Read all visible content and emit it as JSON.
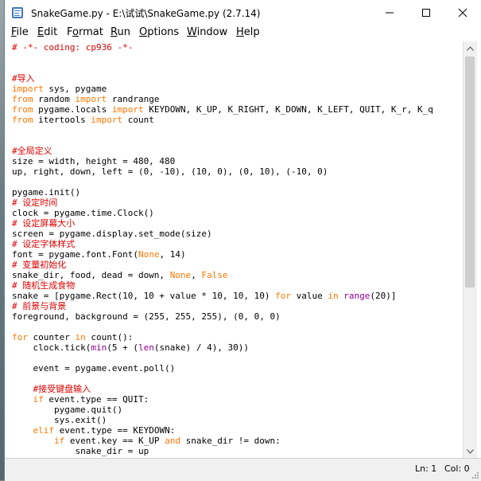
{
  "window": {
    "title": "SnakeGame.py - E:\\试试\\SnakeGame.py (2.7.14)",
    "minimize_glyph": "—",
    "maximize_glyph": "☐",
    "close_glyph": "✕"
  },
  "menu": [
    "File",
    "Edit",
    "Format",
    "Run",
    "Options",
    "Window",
    "Help"
  ],
  "menu_underline": [
    "F",
    "E",
    "o",
    "R",
    "O",
    "W",
    "H"
  ],
  "code_lines": [
    [
      [
        "# -*- coding: cp936 -*-",
        "c"
      ]
    ],
    [],
    [],
    [
      [
        "#导入",
        "c"
      ]
    ],
    [
      [
        "import",
        "k"
      ],
      [
        " sys, pygame",
        "t"
      ]
    ],
    [
      [
        "from",
        "k"
      ],
      [
        " random ",
        "t"
      ],
      [
        "import",
        "k"
      ],
      [
        " randrange",
        "t"
      ]
    ],
    [
      [
        "from",
        "k"
      ],
      [
        " pygame.locals ",
        "t"
      ],
      [
        "import",
        "k"
      ],
      [
        " KEYDOWN, K_UP, K_RIGHT, K_DOWN, K_LEFT, QUIT, K_r, K_q",
        "t"
      ]
    ],
    [
      [
        "from",
        "k"
      ],
      [
        " itertools ",
        "t"
      ],
      [
        "import",
        "k"
      ],
      [
        " count",
        "t"
      ]
    ],
    [],
    [],
    [
      [
        "#全局定义",
        "c"
      ]
    ],
    [
      [
        "size = width, height = 480, 480",
        "t"
      ]
    ],
    [
      [
        "up, right, down, left = (0, -10), (10, 0), (0, 10), (-10, 0)",
        "t"
      ]
    ],
    [],
    [
      [
        "pygame.init()",
        "t"
      ]
    ],
    [
      [
        "# 设定时间",
        "c"
      ]
    ],
    [
      [
        "clock = pygame.time.Clock()",
        "t"
      ]
    ],
    [
      [
        "# 设定屏幕大小",
        "c"
      ]
    ],
    [
      [
        "screen = pygame.display.set_mode(size)",
        "t"
      ]
    ],
    [
      [
        "# 设定字体样式",
        "c"
      ]
    ],
    [
      [
        "font = pygame.font.Font(",
        "t"
      ],
      [
        "None",
        "k"
      ],
      [
        ", 14)",
        "t"
      ]
    ],
    [
      [
        "# 变量初始化",
        "c"
      ]
    ],
    [
      [
        "snake_dir, food, dead = down, ",
        "t"
      ],
      [
        "None",
        "k"
      ],
      [
        ", ",
        "t"
      ],
      [
        "False",
        "k"
      ]
    ],
    [
      [
        "# 随机生成食物",
        "c"
      ]
    ],
    [
      [
        "snake = [pygame.Rect(10, 10 + value * 10, 10, 10) ",
        "t"
      ],
      [
        "for",
        "k"
      ],
      [
        " value ",
        "t"
      ],
      [
        "in",
        "k"
      ],
      [
        " ",
        "t"
      ],
      [
        "range",
        "b"
      ],
      [
        "(20)]",
        "t"
      ]
    ],
    [
      [
        "# 前景与背景",
        "c"
      ]
    ],
    [
      [
        "foreground, background = (255, 255, 255), (0, 0, 0)",
        "t"
      ]
    ],
    [],
    [
      [
        "for",
        "k"
      ],
      [
        " counter ",
        "t"
      ],
      [
        "in",
        "k"
      ],
      [
        " count():",
        "t"
      ]
    ],
    [
      [
        "    clock.tick(",
        "t"
      ],
      [
        "min",
        "b"
      ],
      [
        "(5 + (",
        "t"
      ],
      [
        "len",
        "b"
      ],
      [
        "(snake) / 4), 30))",
        "t"
      ]
    ],
    [],
    [
      [
        "    event = pygame.event.poll()",
        "t"
      ]
    ],
    [],
    [
      [
        "    #接受键盘输入",
        "c"
      ]
    ],
    [
      [
        "    ",
        "t"
      ],
      [
        "if",
        "k"
      ],
      [
        " event.type == QUIT:",
        "t"
      ]
    ],
    [
      [
        "        pygame.quit()",
        "t"
      ]
    ],
    [
      [
        "        sys.exit()",
        "t"
      ]
    ],
    [
      [
        "    ",
        "t"
      ],
      [
        "elif",
        "k"
      ],
      [
        " event.type == KEYDOWN:",
        "t"
      ]
    ],
    [
      [
        "        ",
        "t"
      ],
      [
        "if",
        "k"
      ],
      [
        " event.key == K_UP ",
        "t"
      ],
      [
        "and",
        "k"
      ],
      [
        " snake_dir != down:",
        "t"
      ]
    ],
    [
      [
        "            snake_dir = up",
        "t"
      ]
    ]
  ],
  "status": {
    "line": "Ln: 1",
    "col": "Col: 0"
  },
  "colors": {
    "keyword": "#ff7700",
    "comment": "#dd0000",
    "builtin": "#900090",
    "text": "#000000"
  }
}
